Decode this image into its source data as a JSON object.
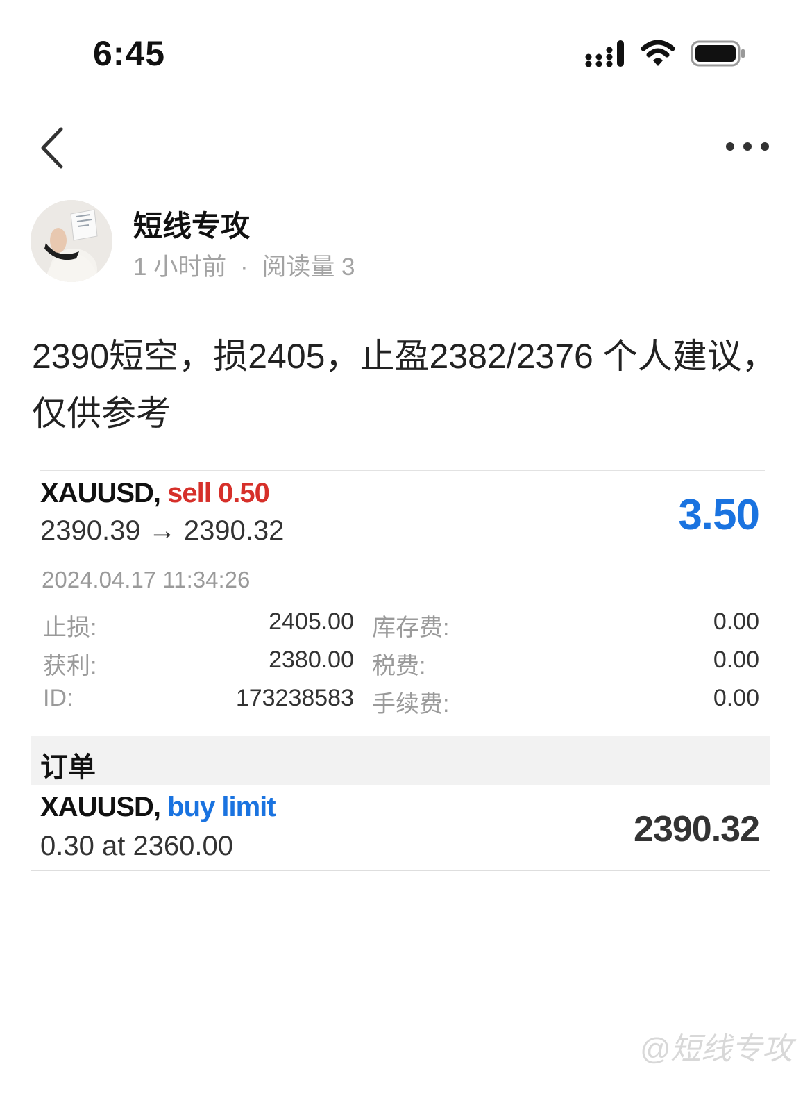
{
  "status_bar": {
    "time": "6:45"
  },
  "author": {
    "name": "短线专攻",
    "time_ago": "1 小时前",
    "separator": "·",
    "read_count": "阅读量 3"
  },
  "post": {
    "text": "2390短空，损2405，止盈2382/2376 个人建议，仅供参考"
  },
  "position": {
    "symbol": "XAUUSD,",
    "side": "sell 0.50",
    "prices": "2390.39 → 2390.32",
    "profit": "3.50",
    "datetime": "2024.04.17 11:34:26",
    "details": {
      "sl_label": "止损:",
      "sl_value": "2405.00",
      "tp_label": "获利:",
      "tp_value": "2380.00",
      "id_label": "ID:",
      "id_value": "173238583",
      "swap_label": "库存费:",
      "swap_value": "0.00",
      "tax_label": "税费:",
      "tax_value": "0.00",
      "fee_label": "手续费:",
      "fee_value": "0.00"
    }
  },
  "orders": {
    "title": "订单",
    "items": [
      {
        "symbol": "XAUUSD,",
        "type": "buy limit",
        "sub": "0.30 at 2360.00",
        "price": "2390.32"
      }
    ]
  },
  "watermark": "@短线专攻",
  "colors": {
    "sell": "#d6302a",
    "profit_blue": "#1a73e0",
    "muted_gray": "#9a9a9a"
  },
  "icons": [
    "signal-icon",
    "wifi-icon",
    "battery-icon",
    "back-arrow-icon",
    "more-options-icon",
    "avatar"
  ]
}
